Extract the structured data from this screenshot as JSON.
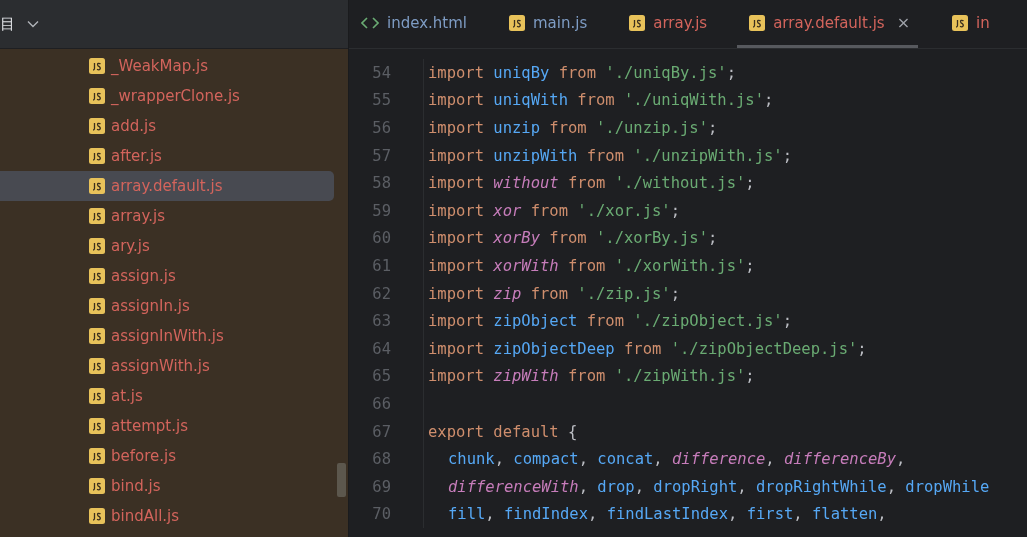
{
  "sidebar": {
    "title": "目",
    "files": [
      {
        "name": "_WeakMap.js",
        "selected": false
      },
      {
        "name": "_wrapperClone.js",
        "selected": false
      },
      {
        "name": "add.js",
        "selected": false
      },
      {
        "name": "after.js",
        "selected": false
      },
      {
        "name": "array.default.js",
        "selected": true
      },
      {
        "name": "array.js",
        "selected": false
      },
      {
        "name": "ary.js",
        "selected": false
      },
      {
        "name": "assign.js",
        "selected": false
      },
      {
        "name": "assignIn.js",
        "selected": false
      },
      {
        "name": "assignInWith.js",
        "selected": false
      },
      {
        "name": "assignWith.js",
        "selected": false
      },
      {
        "name": "at.js",
        "selected": false
      },
      {
        "name": "attempt.js",
        "selected": false
      },
      {
        "name": "before.js",
        "selected": false
      },
      {
        "name": "bind.js",
        "selected": false
      },
      {
        "name": "bindAll.js",
        "selected": false
      }
    ]
  },
  "tabs": [
    {
      "label": "index.html",
      "kind": "html",
      "modified": false,
      "selected": false
    },
    {
      "label": "main.js",
      "kind": "js",
      "modified": false,
      "selected": false
    },
    {
      "label": "array.js",
      "kind": "js",
      "modified": true,
      "selected": false
    },
    {
      "label": "array.default.js",
      "kind": "js",
      "modified": true,
      "selected": true,
      "close": "×"
    },
    {
      "label": "in",
      "kind": "js",
      "modified": true,
      "selected": false
    }
  ],
  "code": [
    {
      "number": "54",
      "tokens": [
        {
          "text": "import ",
          "kind": "kw"
        },
        {
          "text": "uniqBy",
          "kind": "id"
        },
        {
          "text": " from ",
          "kind": "kw"
        },
        {
          "text": "'./uniqBy.js'",
          "kind": "str"
        },
        {
          "text": ";",
          "kind": "p"
        }
      ]
    },
    {
      "number": "55",
      "tokens": [
        {
          "text": "import ",
          "kind": "kw"
        },
        {
          "text": "uniqWith",
          "kind": "id"
        },
        {
          "text": " from ",
          "kind": "kw"
        },
        {
          "text": "'./uniqWith.js'",
          "kind": "str"
        },
        {
          "text": ";",
          "kind": "p"
        }
      ]
    },
    {
      "number": "56",
      "tokens": [
        {
          "text": "import ",
          "kind": "kw"
        },
        {
          "text": "unzip",
          "kind": "id"
        },
        {
          "text": " from ",
          "kind": "kw"
        },
        {
          "text": "'./unzip.js'",
          "kind": "str"
        },
        {
          "text": ";",
          "kind": "p"
        }
      ]
    },
    {
      "number": "57",
      "tokens": [
        {
          "text": "import ",
          "kind": "kw"
        },
        {
          "text": "unzipWith",
          "kind": "id"
        },
        {
          "text": " from ",
          "kind": "kw"
        },
        {
          "text": "'./unzipWith.js'",
          "kind": "str"
        },
        {
          "text": ";",
          "kind": "p"
        }
      ]
    },
    {
      "number": "58",
      "tokens": [
        {
          "text": "import ",
          "kind": "kw"
        },
        {
          "text": "without",
          "kind": "it"
        },
        {
          "text": " from ",
          "kind": "kw"
        },
        {
          "text": "'./without.js'",
          "kind": "str"
        },
        {
          "text": ";",
          "kind": "p"
        }
      ]
    },
    {
      "number": "59",
      "tokens": [
        {
          "text": "import ",
          "kind": "kw"
        },
        {
          "text": "xor",
          "kind": "it"
        },
        {
          "text": " from ",
          "kind": "kw"
        },
        {
          "text": "'./xor.js'",
          "kind": "str"
        },
        {
          "text": ";",
          "kind": "p"
        }
      ]
    },
    {
      "number": "60",
      "tokens": [
        {
          "text": "import ",
          "kind": "kw"
        },
        {
          "text": "xorBy",
          "kind": "it"
        },
        {
          "text": " from ",
          "kind": "kw"
        },
        {
          "text": "'./xorBy.js'",
          "kind": "str"
        },
        {
          "text": ";",
          "kind": "p"
        }
      ]
    },
    {
      "number": "61",
      "tokens": [
        {
          "text": "import ",
          "kind": "kw"
        },
        {
          "text": "xorWith",
          "kind": "it"
        },
        {
          "text": " from ",
          "kind": "kw"
        },
        {
          "text": "'./xorWith.js'",
          "kind": "str"
        },
        {
          "text": ";",
          "kind": "p"
        }
      ]
    },
    {
      "number": "62",
      "tokens": [
        {
          "text": "import ",
          "kind": "kw"
        },
        {
          "text": "zip",
          "kind": "it"
        },
        {
          "text": " from ",
          "kind": "kw"
        },
        {
          "text": "'./zip.js'",
          "kind": "str"
        },
        {
          "text": ";",
          "kind": "p"
        }
      ]
    },
    {
      "number": "63",
      "tokens": [
        {
          "text": "import ",
          "kind": "kw"
        },
        {
          "text": "zipObject",
          "kind": "id"
        },
        {
          "text": " from ",
          "kind": "kw"
        },
        {
          "text": "'./zipObject.js'",
          "kind": "str"
        },
        {
          "text": ";",
          "kind": "p"
        }
      ]
    },
    {
      "number": "64",
      "tokens": [
        {
          "text": "import ",
          "kind": "kw"
        },
        {
          "text": "zipObjectDeep",
          "kind": "id"
        },
        {
          "text": " from ",
          "kind": "kw"
        },
        {
          "text": "'./zipObjectDeep.js'",
          "kind": "str"
        },
        {
          "text": ";",
          "kind": "p"
        }
      ]
    },
    {
      "number": "65",
      "tokens": [
        {
          "text": "import ",
          "kind": "kw"
        },
        {
          "text": "zipWith",
          "kind": "it"
        },
        {
          "text": " from ",
          "kind": "kw"
        },
        {
          "text": "'./zipWith.js'",
          "kind": "str"
        },
        {
          "text": ";",
          "kind": "p"
        }
      ]
    },
    {
      "number": "66"
    },
    {
      "number": "67",
      "tokens": [
        {
          "text": "export default ",
          "kind": "kw"
        },
        {
          "text": "{",
          "kind": "p"
        }
      ]
    },
    {
      "number": "68",
      "indent": true,
      "tokens": [
        {
          "text": "chunk",
          "kind": "id"
        },
        {
          "text": ", ",
          "kind": "p"
        },
        {
          "text": "compact",
          "kind": "id"
        },
        {
          "text": ", ",
          "kind": "p"
        },
        {
          "text": "concat",
          "kind": "id"
        },
        {
          "text": ", ",
          "kind": "p"
        },
        {
          "text": "difference",
          "kind": "it"
        },
        {
          "text": ", ",
          "kind": "p"
        },
        {
          "text": "differenceBy",
          "kind": "it"
        },
        {
          "text": ",",
          "kind": "p"
        }
      ]
    },
    {
      "number": "69",
      "indent": true,
      "tokens": [
        {
          "text": "differenceWith",
          "kind": "it"
        },
        {
          "text": ", ",
          "kind": "p"
        },
        {
          "text": "drop",
          "kind": "id"
        },
        {
          "text": ", ",
          "kind": "p"
        },
        {
          "text": "dropRight",
          "kind": "id"
        },
        {
          "text": ", ",
          "kind": "p"
        },
        {
          "text": "dropRightWhile",
          "kind": "id"
        },
        {
          "text": ", ",
          "kind": "p"
        },
        {
          "text": "dropWhile",
          "kind": "id"
        }
      ]
    },
    {
      "number": "70",
      "indent": true,
      "tokens": [
        {
          "text": "fill",
          "kind": "id"
        },
        {
          "text": ", ",
          "kind": "p"
        },
        {
          "text": "findIndex",
          "kind": "id"
        },
        {
          "text": ", ",
          "kind": "p"
        },
        {
          "text": "findLastIndex",
          "kind": "id"
        },
        {
          "text": ", ",
          "kind": "p"
        },
        {
          "text": "first",
          "kind": "id"
        },
        {
          "text": ", ",
          "kind": "p"
        },
        {
          "text": "flatten",
          "kind": "id"
        },
        {
          "text": ",",
          "kind": "p"
        }
      ]
    }
  ]
}
